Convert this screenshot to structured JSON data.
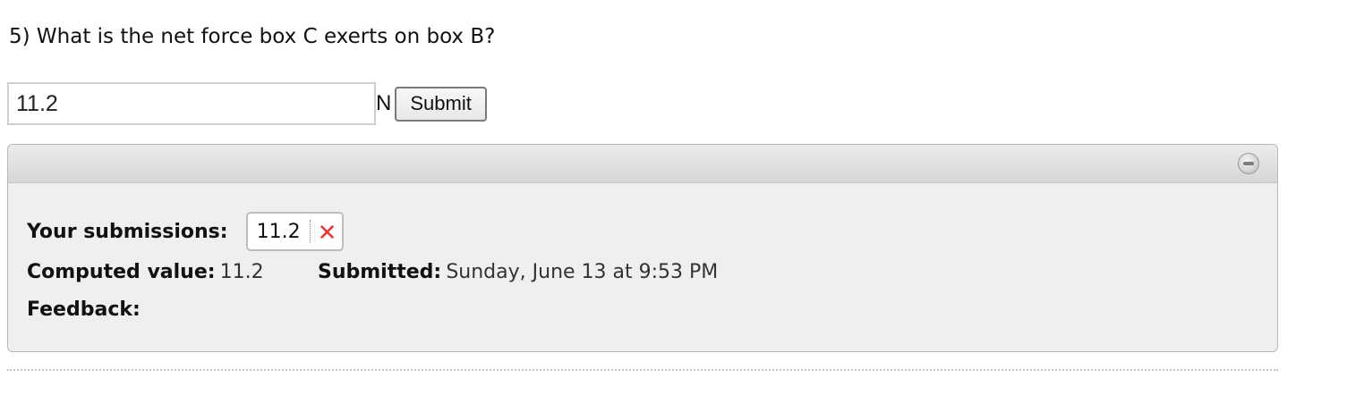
{
  "question": {
    "text": "5) What is the net force box C exerts on box B?"
  },
  "answer": {
    "value": "11.2",
    "unit": "N",
    "submit_label": "Submit"
  },
  "panel": {
    "collapse_icon": "collapse-minus-icon",
    "submissions_label": "Your submissions:",
    "submissions": [
      {
        "value": "11.2",
        "status": "wrong",
        "status_icon": "wrong-x-icon",
        "status_glyph": "✕",
        "status_color": "#e53935"
      }
    ],
    "computed_label": "Computed value:",
    "computed_value": "11.2",
    "submitted_label": "Submitted:",
    "submitted_value": "Sunday, June 13 at 9:53 PM",
    "feedback_label": "Feedback:"
  }
}
